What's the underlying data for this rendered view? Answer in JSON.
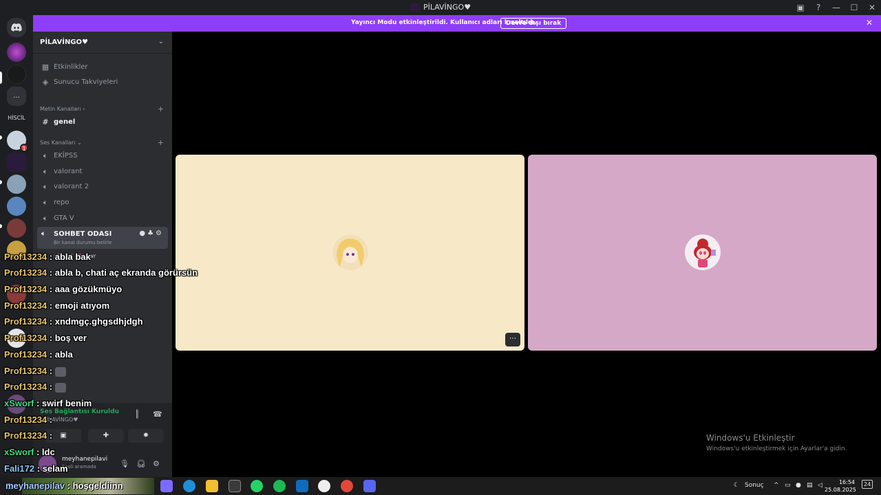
{
  "window": {
    "title": "PİLAVİNGO♥"
  },
  "banner": {
    "message": "Yayıncı Modu etkinleştirildi. Kullanıcı adları kısaltıldı.",
    "button": "Devre dışı bırak"
  },
  "rail": {
    "dm_icon": "discord-logo-icon",
    "folder_label": "...",
    "text_server": "HİSCİL",
    "badge_count": "1"
  },
  "server": {
    "name": "PİLAVİNGO♥"
  },
  "sidebar": {
    "events": "Etkinlikler",
    "boosts": "Sunucu Takviyeleri",
    "text_category": "Metin Kanalları",
    "text_channels": [
      "genel"
    ],
    "voice_category": "Ses Kanalları",
    "voice_channels": [
      "EKİPSS",
      "valorant",
      "valorant 2",
      "repo",
      "GTA V"
    ],
    "active_channel": "SOHBET ODASI",
    "active_channel_status": "Bir kanal durumu belirle",
    "member_name": "xSworf",
    "member_tag": "rawr"
  },
  "voice_panel": {
    "status": "Ses Bağlantısı Kuruldu",
    "server_path": "/ PİLAVİNGO♥",
    "username": "meyhanepilavi",
    "user_status": "Sesli aramada"
  },
  "stage": {
    "tile_colors": [
      "#f7e9c8",
      "#d4a8c6"
    ],
    "watermark_title": "Windows'u Etkinleştir",
    "watermark_sub": "Windows'u etkinleştirmek için Ayarlar'a gidin."
  },
  "chat": [
    {
      "user": "Prof13234",
      "msg": "abla bak",
      "kind": "prof"
    },
    {
      "user": "Prof13234",
      "msg": "abla b, chati aç ekranda görürsün",
      "kind": "prof"
    },
    {
      "user": "Prof13234",
      "msg": "aaa gözükmüyo",
      "kind": "prof"
    },
    {
      "user": "Prof13234",
      "msg": "emoji atıyom",
      "kind": "prof"
    },
    {
      "user": "Prof13234",
      "msg": "xndmgç.ghgsdhjdgh",
      "kind": "prof"
    },
    {
      "user": "Prof13234",
      "msg": "boş ver",
      "kind": "prof"
    },
    {
      "user": "Prof13234",
      "msg": "abla",
      "kind": "prof"
    },
    {
      "user": "Prof13234",
      "msg": "",
      "kind": "prof",
      "emoji": true
    },
    {
      "user": "Prof13234",
      "msg": "",
      "kind": "prof",
      "emoji": true
    },
    {
      "user": "xSworf",
      "msg": "swirf benim",
      "kind": "xs"
    },
    {
      "user": "Prof13234",
      "msg": "",
      "kind": "prof"
    },
    {
      "user": "Prof13234",
      "msg": "",
      "kind": "prof"
    },
    {
      "user": "xSworf",
      "msg": "ldc",
      "kind": "xs"
    },
    {
      "user": "Fali172",
      "msg": "selam",
      "kind": "fali"
    }
  ],
  "taskbar": {
    "ticker_user": "meyhanepilav",
    "ticker_msg": "hoşgeldiinn",
    "weather": "Sonuç",
    "time": "16:54",
    "date": "25.08.2025",
    "notif_count": "24"
  }
}
